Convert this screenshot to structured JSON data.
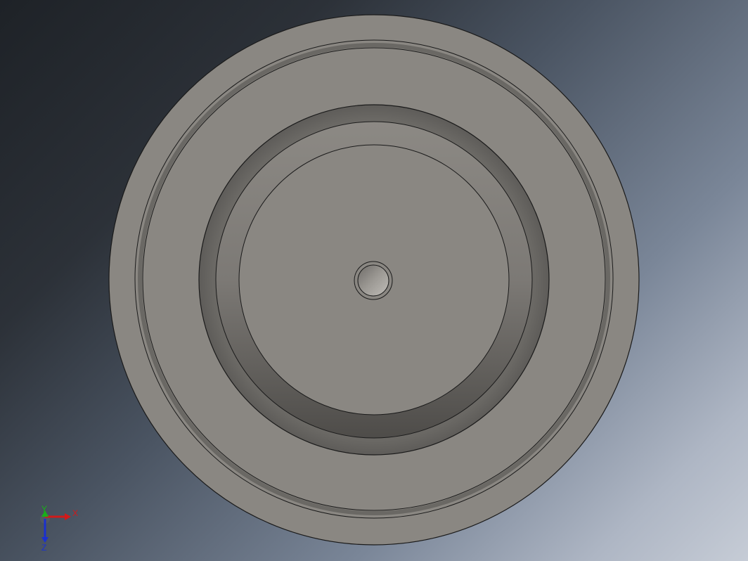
{
  "viewport": {
    "background_dark": "#1e2227",
    "background_light": "#c6ccd6"
  },
  "model": {
    "name": "circular-pulley-part",
    "face_color": "#8a8782",
    "edge_color": "#1a1a1a"
  },
  "triad": {
    "x_label": "X",
    "y_label": "Y",
    "z_label": "Z",
    "x_color": "#d11a1a",
    "y_color": "#18b018",
    "z_color": "#1a30d0"
  }
}
